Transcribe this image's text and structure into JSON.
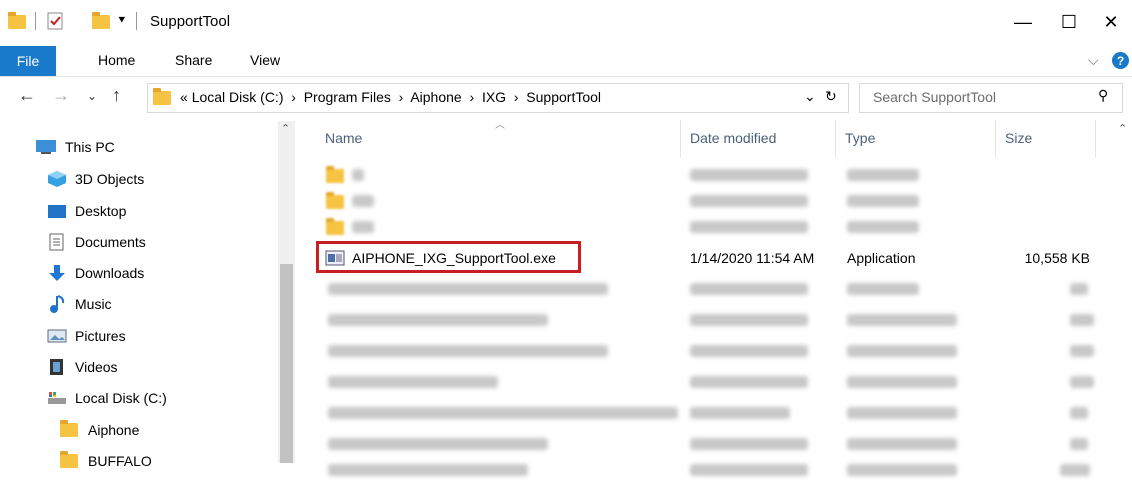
{
  "window": {
    "title": "SupportTool"
  },
  "ribbon": {
    "tabs": [
      "File",
      "Home",
      "Share",
      "View"
    ],
    "help_glyph": "?"
  },
  "address": {
    "path": [
      "Local Disk (C:)",
      "Program Files",
      "Aiphone",
      "IXG",
      "SupportTool"
    ],
    "prefix": "«",
    "search_placeholder": "Search SupportTool"
  },
  "nav_pane": {
    "items": [
      {
        "label": "This PC",
        "icon": "this-pc-icon"
      },
      {
        "label": "3D Objects",
        "icon": "3d-objects-icon"
      },
      {
        "label": "Desktop",
        "icon": "desktop-icon"
      },
      {
        "label": "Documents",
        "icon": "documents-icon"
      },
      {
        "label": "Downloads",
        "icon": "downloads-icon"
      },
      {
        "label": "Music",
        "icon": "music-icon"
      },
      {
        "label": "Pictures",
        "icon": "pictures-icon"
      },
      {
        "label": "Videos",
        "icon": "videos-icon"
      },
      {
        "label": "Local Disk (C:)",
        "icon": "local-disk-icon"
      },
      {
        "label": "Aiphone",
        "icon": "folder-icon"
      },
      {
        "label": "BUFFALO",
        "icon": "folder-icon"
      }
    ]
  },
  "columns": [
    "Name",
    "Date modified",
    "Type",
    "Size"
  ],
  "highlighted_file": {
    "name": "AIPHONE_IXG_SupportTool.exe",
    "date": "1/14/2020 11:54 AM",
    "type": "Application",
    "size": "10,558 KB"
  },
  "colors": {
    "accent": "#1979ca",
    "highlight": "#c81e23",
    "folder": "#f6c343"
  }
}
